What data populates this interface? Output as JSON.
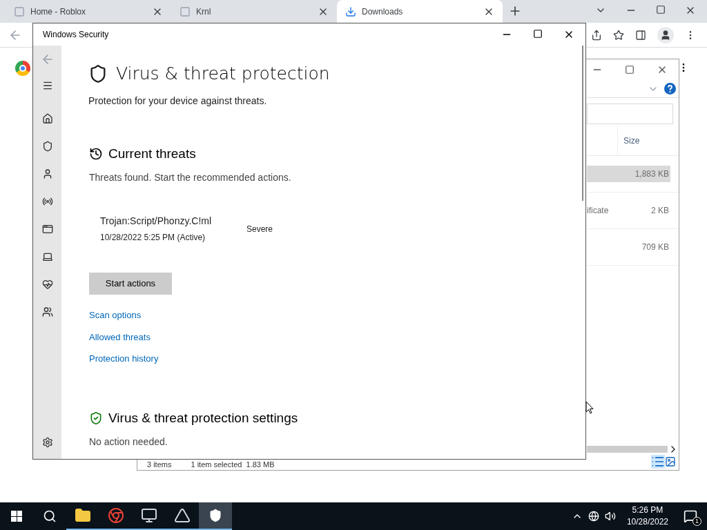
{
  "browser": {
    "tabs": [
      {
        "label": "Home - Roblox",
        "selected": false
      },
      {
        "label": "Krnl",
        "selected": false
      },
      {
        "label": "Downloads",
        "selected": true
      }
    ]
  },
  "explorer": {
    "size_header": "Size",
    "rows": [
      {
        "name": "",
        "size": "1,883 KB",
        "selected": true
      },
      {
        "name": "ificate",
        "size": "2 KB",
        "selected": false
      },
      {
        "name": "",
        "size": "709 KB",
        "selected": false
      }
    ],
    "status": [
      "3 items",
      "1 item selected  1.83 MB"
    ]
  },
  "security": {
    "window_title": "Windows Security",
    "title": "Virus & threat protection",
    "subtitle": "Protection for your device against threats.",
    "current": {
      "heading": "Current threats",
      "text": "Threats found. Start the recommended actions."
    },
    "threats": [
      {
        "name": "Trojan:Script/Phonzy.C!ml",
        "date": "10/28/2022 5:25 PM (Active)",
        "severity": "Severe"
      }
    ],
    "action_button": "Start actions",
    "links": [
      "Scan options",
      "Allowed threats",
      "Protection history"
    ],
    "settings": {
      "heading": "Virus & threat protection settings",
      "text": "No action needed."
    }
  },
  "taskbar": {
    "apps": [
      {
        "kind": "explorer",
        "selected": false
      },
      {
        "kind": "chrome",
        "selected": false
      },
      {
        "kind": "monitor",
        "selected": false
      },
      {
        "kind": "krnl",
        "selected": false
      },
      {
        "kind": "security",
        "selected": true
      }
    ],
    "time": "5:26 PM",
    "date": "10/28/2022",
    "notifications": "1"
  }
}
